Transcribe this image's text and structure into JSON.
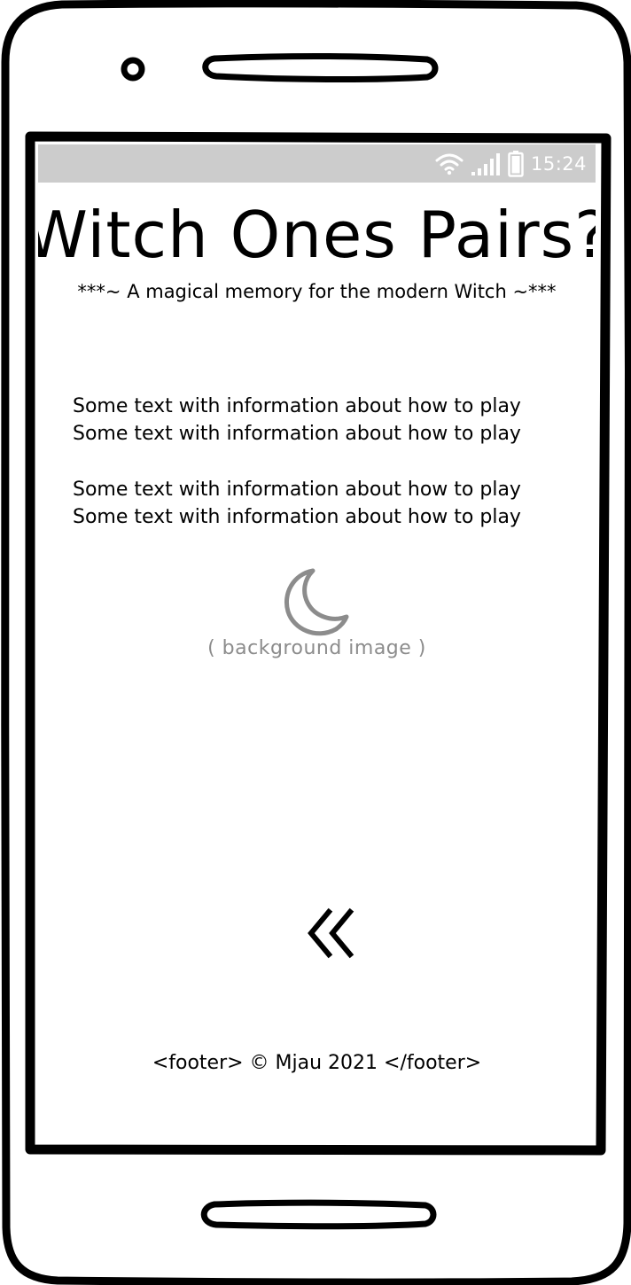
{
  "status_bar": {
    "time": "15:24",
    "icons": [
      "wifi-icon",
      "signal-icon",
      "battery-icon"
    ]
  },
  "header": {
    "title": "Witch Ones Pairs?",
    "subtitle": "***~ A magical memory for the modern Witch ~***"
  },
  "info": {
    "paragraphs": [
      {
        "lines": [
          "Some text with information about how to play",
          "Some text with information about how to play"
        ]
      },
      {
        "lines": [
          "Some text with information about how to play",
          "Some text with information about how to play"
        ]
      }
    ]
  },
  "background": {
    "icon": "moon-icon",
    "caption": "( background image )"
  },
  "navigation": {
    "back_icon": "double-chevron-left-icon"
  },
  "footer": {
    "text": "<footer>  © Mjau 2021 </footer>"
  },
  "colors": {
    "frame": "#000000",
    "statusbar": "#cccccc",
    "placeholder": "#8c8c8c",
    "text": "#000000"
  }
}
